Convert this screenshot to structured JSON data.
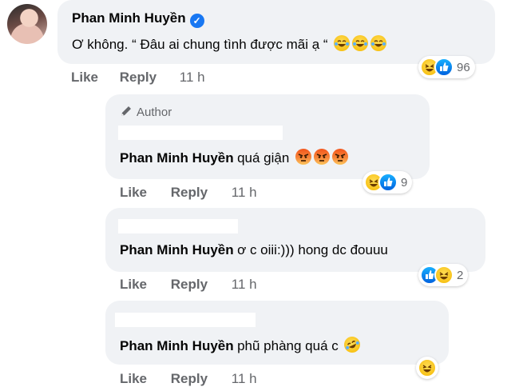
{
  "comments": [
    {
      "author": "Phan Minh Huyền",
      "verified": true,
      "text": "Ơ không. “ Đâu ai chung tình được mãi ạ “",
      "emojis": [
        "laughing-tears-icon",
        "laughing-tears-icon",
        "laughing-tears-icon"
      ],
      "reactions": {
        "icons": [
          "haha",
          "like"
        ],
        "count": "96"
      },
      "actions": {
        "like": "Like",
        "reply": "Reply",
        "time": "11 h"
      }
    }
  ],
  "replies": [
    {
      "badge": "Author",
      "author": "Phan Minh Huyền",
      "text": "quá giận",
      "emojis": [
        "angry-icon",
        "angry-icon",
        "angry-icon"
      ],
      "reactions": {
        "icons": [
          "haha",
          "like"
        ],
        "count": "9"
      },
      "actions": {
        "like": "Like",
        "reply": "Reply",
        "time": "11 h"
      }
    },
    {
      "author": "Phan Minh Huyền",
      "text": "ơ c oiii:))) hong dc đouuu",
      "reactions": {
        "icons": [
          "like",
          "haha"
        ],
        "count": "2"
      },
      "actions": {
        "like": "Like",
        "reply": "Reply",
        "time": "11 h"
      }
    },
    {
      "author": "Phan Minh Huyền",
      "text": "phũ phàng quá c",
      "emojis": [
        "rolling-laughing-icon"
      ],
      "reactions": {
        "icons": [
          "haha"
        ],
        "count": ""
      },
      "actions": {
        "like": "Like",
        "reply": "Reply",
        "time": "11 h"
      }
    }
  ],
  "colors": {
    "bubble": "#f0f2f5",
    "secondary_text": "#65676b",
    "verified": "#1877f2",
    "like": "#1877f2",
    "haha": "#f7b125",
    "angry": "#f3551b"
  }
}
